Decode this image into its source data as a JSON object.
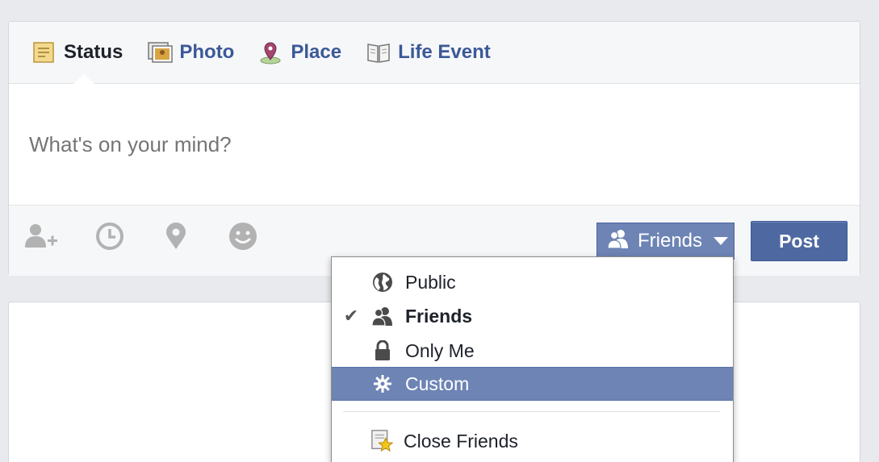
{
  "composer": {
    "tabs": [
      {
        "label": "Status",
        "icon": "status-note-icon",
        "active": true
      },
      {
        "label": "Photo",
        "icon": "photo-icon"
      },
      {
        "label": "Place",
        "icon": "place-pin-icon"
      },
      {
        "label": "Life Event",
        "icon": "life-event-book-icon"
      }
    ],
    "status_placeholder": "What's on your mind?",
    "toolbar": {
      "icons": [
        "tag-friends-icon",
        "clock-icon",
        "location-pin-icon",
        "smiley-icon"
      ],
      "audience_label": "Friends",
      "post_label": "Post"
    }
  },
  "audience_menu": {
    "items": [
      {
        "label": "Public",
        "icon": "globe-icon",
        "checked": false
      },
      {
        "label": "Friends",
        "icon": "friends-icon",
        "checked": true
      },
      {
        "label": "Only Me",
        "icon": "lock-icon",
        "checked": false
      },
      {
        "label": "Custom",
        "icon": "gear-icon",
        "checked": false,
        "highlighted": true
      },
      {
        "label": "Close Friends",
        "icon": "close-friends-star-icon",
        "checked": false
      }
    ],
    "checkmark": "✔"
  },
  "colors": {
    "link": "#3b5998",
    "highlight": "#6d84b4",
    "post_button": "#4e69a2",
    "page_bg": "#e9eaed"
  }
}
